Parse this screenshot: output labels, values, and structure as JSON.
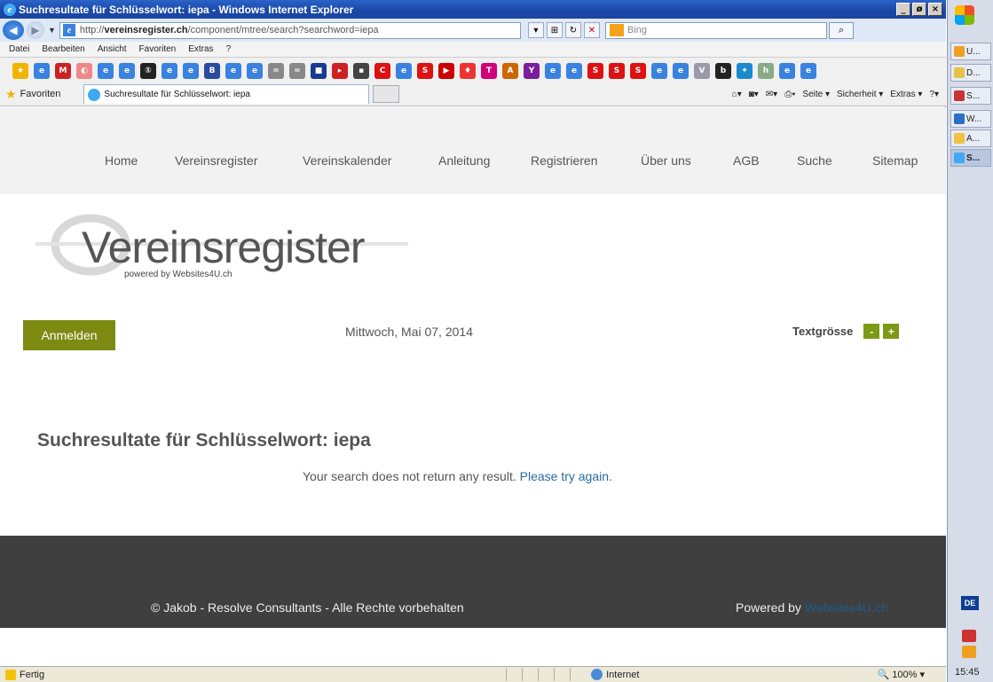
{
  "window": {
    "title": "Suchresultate für Schlüsselwort: iepa - Windows Internet Explorer",
    "min": "_",
    "max": "ø",
    "close": "×"
  },
  "address": {
    "url_prefix": "http://",
    "url_domain": "vereinsregister.ch",
    "url_path": "/component/mtree/search?searchword=iepa",
    "search_placeholder": "Bing"
  },
  "menubar": [
    "Datei",
    "Bearbeiten",
    "Ansicht",
    "Favoriten",
    "Extras",
    "?"
  ],
  "favorites": {
    "label": "Favoriten",
    "tab_title": "Suchresultate für Schlüsselwort: iepa",
    "commands": [
      "Seite ▾",
      "Sicherheit ▾",
      "Extras ▾"
    ]
  },
  "site": {
    "nav": [
      "Home",
      "Vereinsregister",
      "Vereinskalender",
      "Anleitung",
      "Registrieren",
      "Über uns",
      "AGB",
      "Suche",
      "Sitemap"
    ],
    "logo_text": "Vereinsregister",
    "logo_sub": "powered by Websites4U.ch",
    "login": "Anmelden",
    "date": "Mittwoch, Mai 07, 2014",
    "textsize_label": "Textgrösse",
    "textsize_minus": "-",
    "textsize_plus": "+",
    "heading": "Suchresultate für Schlüsselwort: iepa",
    "no_result": "Your search does not return any result.",
    "try_again": "Please try again.",
    "footer_copy": "© Jakob - Resolve Consultants - Alle Rechte vorbehalten",
    "powered_by": "Powered by",
    "powered_link": "Websites4U.ch"
  },
  "status": {
    "text": "Fertig",
    "zone": "Internet",
    "zoom": "100%"
  },
  "taskbar": {
    "items": [
      "U...",
      "D...",
      "S...",
      "W...",
      "A...",
      "S..."
    ],
    "lang": "DE",
    "clock": "15:45"
  }
}
